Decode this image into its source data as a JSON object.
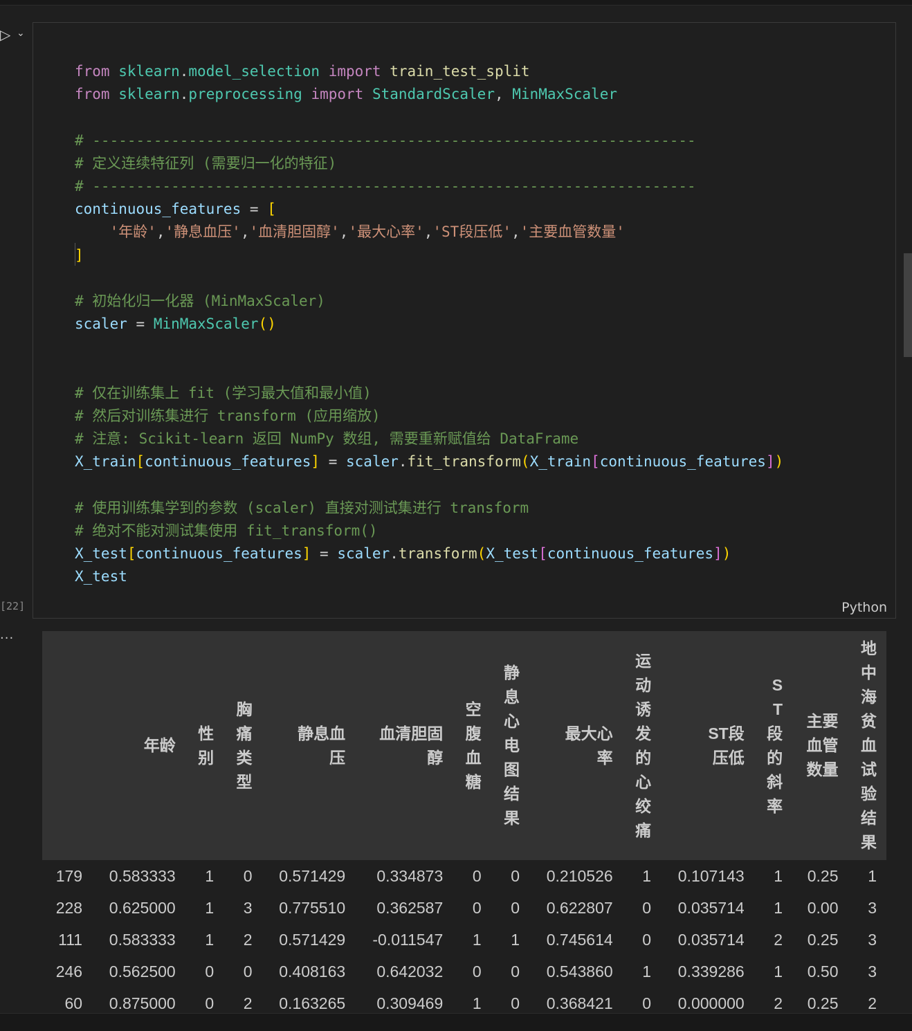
{
  "gutter": {
    "execution_count": "[22]",
    "output_menu": "···"
  },
  "cell": {
    "language": "Python"
  },
  "table": {
    "columns": [
      "",
      "年龄",
      "性别",
      "胸痛类型",
      "静息血压",
      "血清胆固醇",
      "空腹血糖",
      "静息心电图结果",
      "最大心率",
      "运动诱发的心绞痛",
      "ST段压低",
      "ST段的斜率",
      "主要血管数量",
      "地中海贫血试验结果"
    ],
    "rows": [
      [
        "179",
        "0.583333",
        "1",
        "0",
        "0.571429",
        "0.334873",
        "0",
        "0",
        "0.210526",
        "1",
        "0.107143",
        "1",
        "0.25",
        "1"
      ],
      [
        "228",
        "0.625000",
        "1",
        "3",
        "0.775510",
        "0.362587",
        "0",
        "0",
        "0.622807",
        "0",
        "0.035714",
        "1",
        "0.00",
        "3"
      ],
      [
        "111",
        "0.583333",
        "1",
        "2",
        "0.571429",
        "-0.011547",
        "1",
        "1",
        "0.745614",
        "0",
        "0.035714",
        "2",
        "0.25",
        "3"
      ],
      [
        "246",
        "0.562500",
        "0",
        "0",
        "0.408163",
        "0.642032",
        "0",
        "0",
        "0.543860",
        "1",
        "0.339286",
        "1",
        "0.50",
        "3"
      ],
      [
        "60",
        "0.875000",
        "0",
        "2",
        "0.163265",
        "0.309469",
        "1",
        "0",
        "0.368421",
        "0",
        "0.000000",
        "2",
        "0.25",
        "2"
      ]
    ]
  }
}
